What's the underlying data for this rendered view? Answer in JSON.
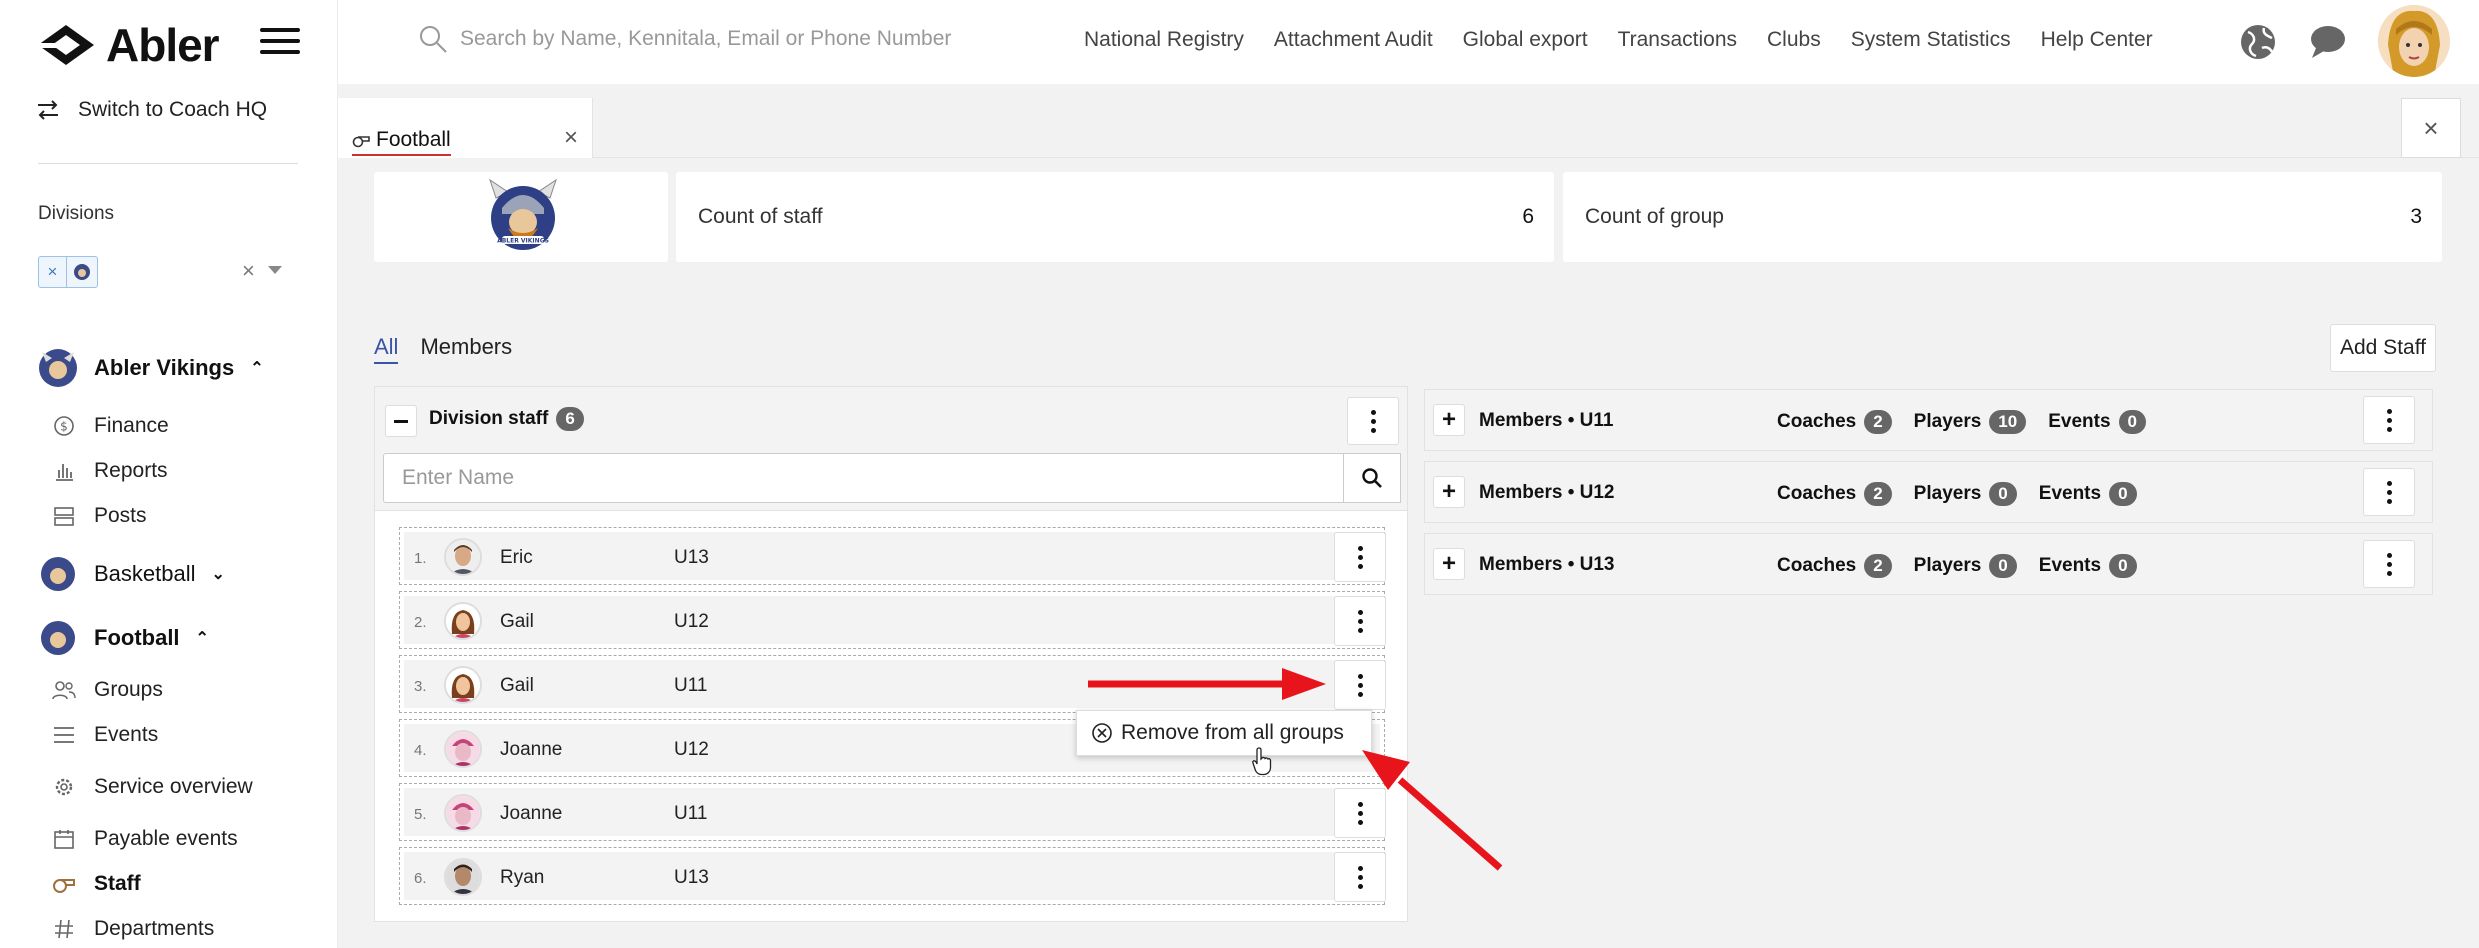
{
  "sidebar": {
    "logo_text": "Abler",
    "switch_label": "Switch to Coach HQ",
    "divisions_label": "Divisions",
    "division_chip_remove": "×",
    "division_clear": "×",
    "clubs": [
      {
        "name": "Abler Vikings",
        "expanded": true
      },
      {
        "name": "Basketball",
        "expanded": false
      },
      {
        "name": "Football",
        "expanded": true
      }
    ],
    "club_nav": [
      {
        "label": "Finance",
        "icon": "dollar-icon"
      },
      {
        "label": "Reports",
        "icon": "bar-chart-icon"
      },
      {
        "label": "Posts",
        "icon": "posts-icon"
      }
    ],
    "football_nav": [
      {
        "label": "Groups",
        "icon": "groups-icon"
      },
      {
        "label": "Events",
        "icon": "list-icon"
      },
      {
        "label": "Service overview",
        "icon": "gear-icon"
      },
      {
        "label": "Payable events",
        "icon": "calendar-icon"
      },
      {
        "label": "Staff",
        "icon": "whistle-icon",
        "active": true
      },
      {
        "label": "Departments",
        "icon": "hash-icon"
      }
    ]
  },
  "header": {
    "search_placeholder": "Search by Name, Kennitala, Email or Phone Number",
    "nav": [
      "National Registry",
      "Attachment Audit",
      "Global export",
      "Transactions",
      "Clubs",
      "System Statistics",
      "Help Center"
    ]
  },
  "tabbar": {
    "tab_label": "Football",
    "tab_close": "×",
    "window_close": "×"
  },
  "stats": {
    "count_staff_label": "Count of staff",
    "count_staff_value": "6",
    "count_group_label": "Count of group",
    "count_group_value": "3"
  },
  "subtabs": {
    "all": "All",
    "members": "Members"
  },
  "add_staff_label": "Add Staff",
  "division_staff": {
    "title": "Division staff",
    "count": "6",
    "input_placeholder": "Enter Name",
    "rows": [
      {
        "index": "1.",
        "name": "Eric",
        "group": "U13"
      },
      {
        "index": "2.",
        "name": "Gail",
        "group": "U12"
      },
      {
        "index": "3.",
        "name": "Gail",
        "group": "U11"
      },
      {
        "index": "4.",
        "name": "Joanne",
        "group": "U12"
      },
      {
        "index": "5.",
        "name": "Joanne",
        "group": "U11"
      },
      {
        "index": "6.",
        "name": "Ryan",
        "group": "U13"
      }
    ]
  },
  "context_menu": {
    "remove_label": "Remove from all groups"
  },
  "groups": [
    {
      "name": "Members • U11",
      "coaches_label": "Coaches",
      "coaches": "2",
      "players_label": "Players",
      "players": "10",
      "events_label": "Events",
      "events": "0"
    },
    {
      "name": "Members • U12",
      "coaches_label": "Coaches",
      "coaches": "2",
      "players_label": "Players",
      "players": "0",
      "events_label": "Events",
      "events": "0"
    },
    {
      "name": "Members • U13",
      "coaches_label": "Coaches",
      "coaches": "2",
      "players_label": "Players",
      "players": "0",
      "events_label": "Events",
      "events": "0"
    }
  ],
  "colors": {
    "accent": "#3a55a6",
    "annotation_arrow": "#e8141c",
    "badge": "#666666"
  }
}
